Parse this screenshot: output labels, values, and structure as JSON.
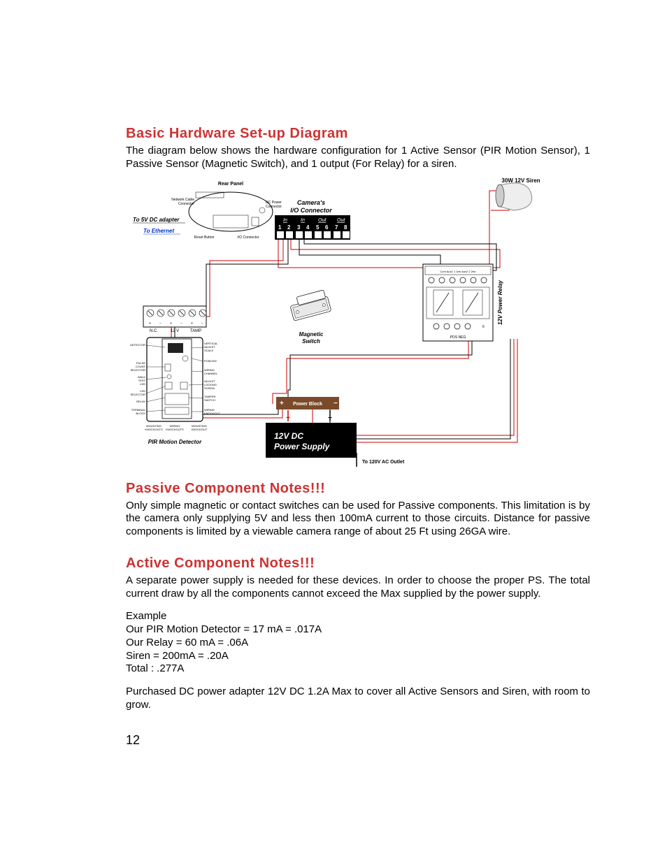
{
  "headings": {
    "h1": "Basic Hardware Set-up Diagram",
    "h2": "Passive Component Notes!!!",
    "h3": "Active Component Notes!!!"
  },
  "intro": "The diagram below shows the hardware configuration for 1 Active Sensor (PIR Motion Sensor), 1 Passive Sensor (Magnetic Switch), and 1 output (For Relay) for a siren.",
  "passive": "Only simple magnetic or contact switches can be used for Passive components. This limitation is by the camera only supplying 5V and less then 100mA current to those circuits. Distance for passive components is limited by a viewable camera range of about 25 Ft using 26GA wire.",
  "active1": "A separate power supply is needed for these devices. In order to choose the proper PS. The total current draw by all the components cannot exceed the Max supplied by the power supply.",
  "example_label": "Example",
  "ex1": "Our PIR Motion Detector = 17 mA  = .017A",
  "ex2": "Our Relay = 60 mA = .06A",
  "ex3": "Siren = 200mA = .20A",
  "ex4": "Total : .277A",
  "active2": "Purchased DC power adapter 12V DC 1.2A Max to cover all Active Sensors and Siren, with room to grow.",
  "page_number": "12",
  "diagram": {
    "siren_label": "30W 12V Siren",
    "io_label": "Camera's",
    "io_label2": "I/O Connector",
    "io_in": "In",
    "io_out": "Out",
    "io_nums": [
      "1",
      "2",
      "3",
      "4",
      "5",
      "6",
      "7",
      "8"
    ],
    "rear_panel": "Rear Panel",
    "net_cable": "Network Cable",
    "net_cable2": "Connector",
    "dc_power": "DC Power",
    "dc_power2": "Connector",
    "to_5v": "To 5V DC adapter",
    "to_eth": "To Ethernet",
    "reset_btn": "Reset Button",
    "io_conn": "I/O Connector",
    "mag_switch": "Magnetic",
    "mag_switch2": "Switch",
    "power_block": "Power Block",
    "ps1": "12V DC",
    "ps2": "Power Supply",
    "to_120": "To 120V AC Outlet",
    "relay_label": "12V Power Relay",
    "pir_label": "PIR Motion Detector",
    "term_nc": "N.C.",
    "term_12v": "12 V",
    "term_tamp": "TAMP",
    "pir_detector": "DETECTOR",
    "pir_vert": "VERTICAL",
    "pir_adj": "ADJUST",
    "pir_scale": "SCALE",
    "pir_pulse": "PULSE",
    "pir_count": "COUNT",
    "pir_sel": "SELECTOR",
    "pir_walk": "WALK",
    "pir_test": "TEST",
    "pir_led": "LED",
    "pir_ledsel": "LED",
    "pir_ledsel2": "SELECTOR",
    "pir_relay": "RELAY",
    "pir_tblock": "TERMINAL",
    "pir_tblock2": "BLOCK",
    "pir_pcblem": "PCB/LEM",
    "pir_wiring": "WIRING",
    "pir_channel": "CHANNEL",
    "pir_adjlock": "ADJUST",
    "pir_lock": "LOCKING",
    "pir_screw": "SCREW",
    "pir_tamper": "TAMPER",
    "pir_switch": "SWITCH",
    "pir_wknock": "WIRING",
    "pir_knock": "KNOCKOUT",
    "pir_mknocks": "MOUNTING",
    "pir_knocks": "KNOCKOUTS",
    "relay_top1": "Com  Aux1  1  1rtn  Aux2  2  2rtn",
    "relay_pos": "POS NEG"
  }
}
